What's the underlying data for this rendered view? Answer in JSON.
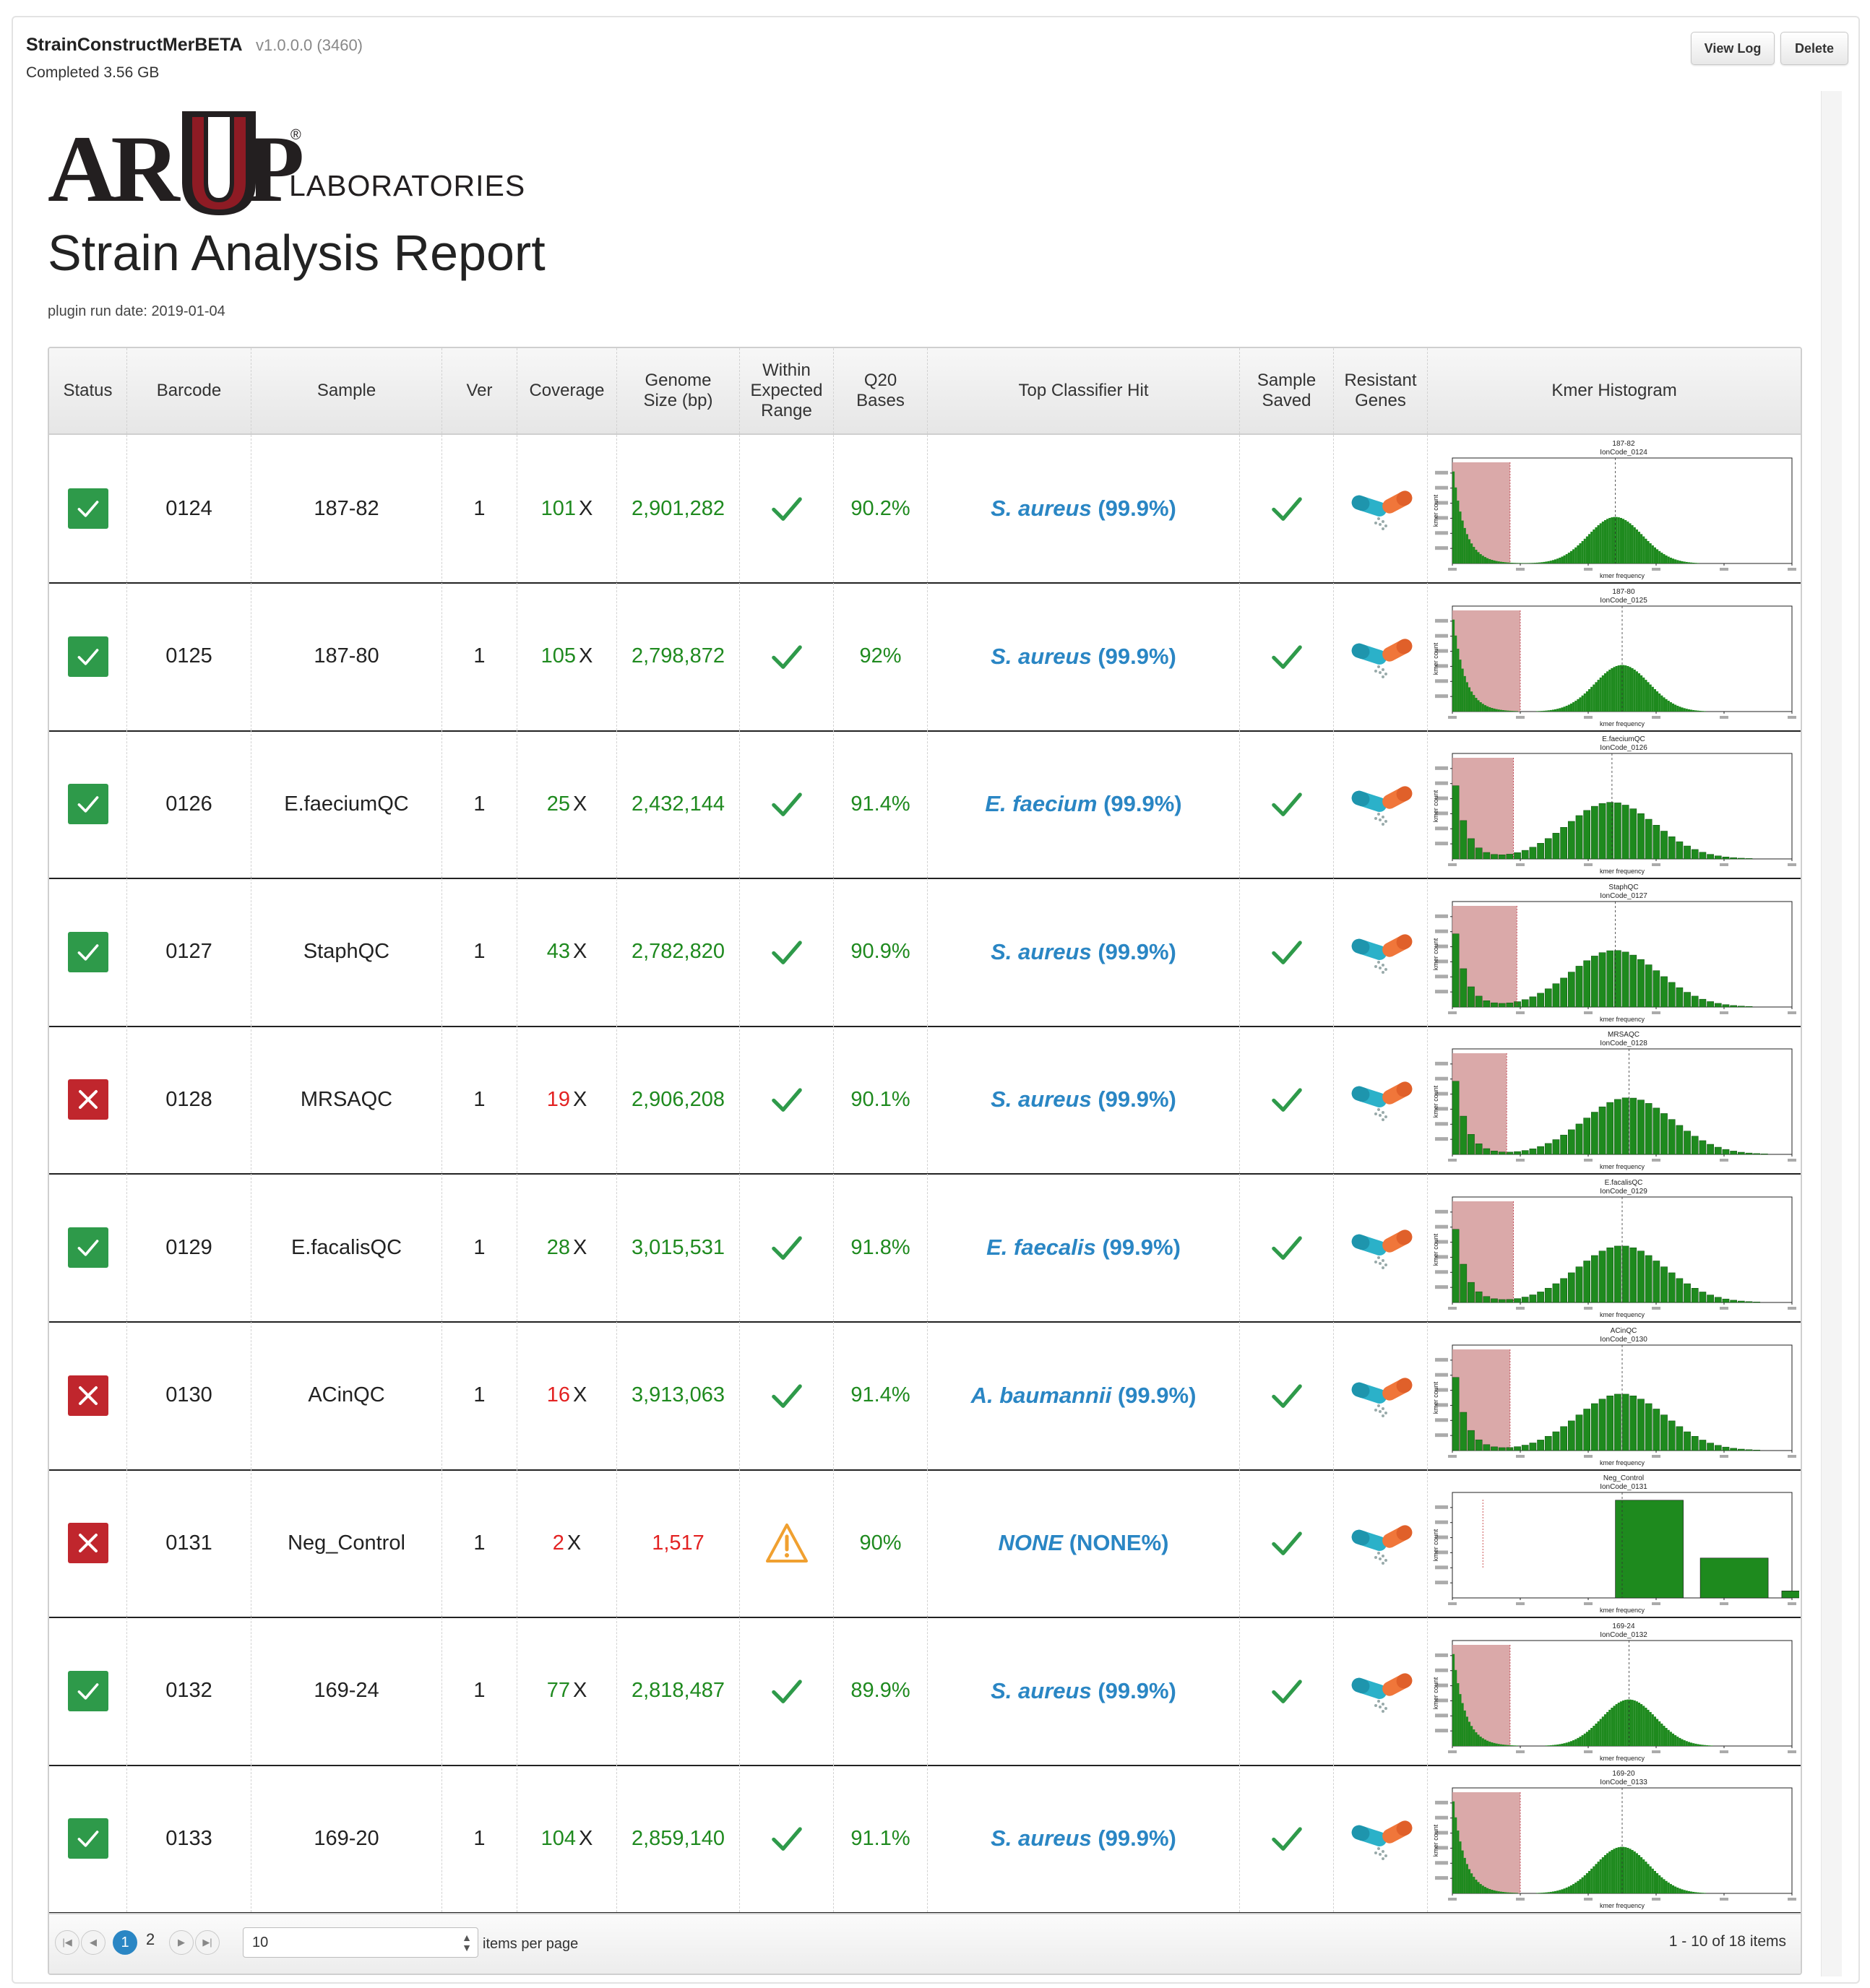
{
  "plugin": {
    "name": "StrainConstructMerBETA",
    "version": "v1.0.0.0 (3460)",
    "status": "Completed 3.56 GB",
    "view_log_label": "View Log",
    "delete_label": "Delete"
  },
  "report": {
    "logo_text": "ARUP",
    "logo_sub": "LABORATORIES",
    "logo_reg": "®",
    "title": "Strain Analysis Report",
    "run_date": "plugin run date: 2019-01-04"
  },
  "colors": {
    "pass": "#2e9a4a",
    "fail": "#c0262d",
    "good_value": "#1f8a1f",
    "bad_value": "#e32222",
    "hit_blue": "#2a86c4",
    "hist_green": "#1e8a1e",
    "hist_shade": "#d49a9a",
    "warning": "#f0a030"
  },
  "table": {
    "headers": {
      "status": "Status",
      "barcode": "Barcode",
      "sample": "Sample",
      "ver": "Ver",
      "coverage": "Coverage",
      "genome_size": "Genome Size (bp)",
      "within_range": "Within Expected Range",
      "q20": "Q20 Bases",
      "top_hit": "Top Classifier Hit",
      "sample_saved": "Sample Saved",
      "resistant": "Resistant Genes",
      "kmer": "Kmer Histogram"
    },
    "rows": [
      {
        "status": "pass",
        "barcode": "0124",
        "sample": "187-82",
        "ver": "1",
        "coverage": "101",
        "coverage_ok": true,
        "genome_size": "2,901,282",
        "genome_ok": true,
        "within_range": "check",
        "q20": "90.2%",
        "hit_species": "S. aureus",
        "hit_pct": "(99.9%)",
        "hist_title1": "187-82",
        "hist_title2": "IonCode_0124",
        "hist_shape": "tall",
        "hist_peak": 0.48,
        "hist_shade_end": 0.17
      },
      {
        "status": "pass",
        "barcode": "0125",
        "sample": "187-80",
        "ver": "1",
        "coverage": "105",
        "coverage_ok": true,
        "genome_size": "2,798,872",
        "genome_ok": true,
        "within_range": "check",
        "q20": "92%",
        "hit_species": "S. aureus",
        "hit_pct": "(99.9%)",
        "hist_title1": "187-80",
        "hist_title2": "IonCode_0125",
        "hist_shape": "tall",
        "hist_peak": 0.5,
        "hist_shade_end": 0.2
      },
      {
        "status": "pass",
        "barcode": "0126",
        "sample": "E.faeciumQC",
        "ver": "1",
        "coverage": "25",
        "coverage_ok": true,
        "genome_size": "2,432,144",
        "genome_ok": true,
        "within_range": "check",
        "q20": "91.4%",
        "hit_species": "E. faecium",
        "hit_pct": "(99.9%)",
        "hist_title1": "E.faeciumQC",
        "hist_title2": "IonCode_0126",
        "hist_shape": "wide",
        "hist_peak": 0.47,
        "hist_shade_end": 0.18
      },
      {
        "status": "pass",
        "barcode": "0127",
        "sample": "StaphQC",
        "ver": "1",
        "coverage": "43",
        "coverage_ok": true,
        "genome_size": "2,782,820",
        "genome_ok": true,
        "within_range": "check",
        "q20": "90.9%",
        "hit_species": "S. aureus",
        "hit_pct": "(99.9%)",
        "hist_title1": "StaphQC",
        "hist_title2": "IonCode_0127",
        "hist_shape": "wide",
        "hist_peak": 0.48,
        "hist_shade_end": 0.19
      },
      {
        "status": "fail",
        "barcode": "0128",
        "sample": "MRSAQC",
        "ver": "1",
        "coverage": "19",
        "coverage_ok": false,
        "genome_size": "2,906,208",
        "genome_ok": true,
        "within_range": "check",
        "q20": "90.1%",
        "hit_species": "S. aureus",
        "hit_pct": "(99.9%)",
        "hist_title1": "MRSAQC",
        "hist_title2": "IonCode_0128",
        "hist_shape": "wide",
        "hist_peak": 0.52,
        "hist_shade_end": 0.16
      },
      {
        "status": "pass",
        "barcode": "0129",
        "sample": "E.facalisQC",
        "ver": "1",
        "coverage": "28",
        "coverage_ok": true,
        "genome_size": "3,015,531",
        "genome_ok": true,
        "within_range": "check",
        "q20": "91.8%",
        "hit_species": "E. faecalis",
        "hit_pct": "(99.9%)",
        "hist_title1": "E.facalisQC",
        "hist_title2": "IonCode_0129",
        "hist_shape": "wide",
        "hist_peak": 0.5,
        "hist_shade_end": 0.18
      },
      {
        "status": "fail",
        "barcode": "0130",
        "sample": "ACinQC",
        "ver": "1",
        "coverage": "16",
        "coverage_ok": false,
        "genome_size": "3,913,063",
        "genome_ok": true,
        "within_range": "check",
        "q20": "91.4%",
        "hit_species": "A. baumannii",
        "hit_pct": "(99.9%)",
        "hist_title1": "ACinQC",
        "hist_title2": "IonCode_0130",
        "hist_shape": "wide",
        "hist_peak": 0.5,
        "hist_shade_end": 0.17
      },
      {
        "status": "fail",
        "barcode": "0131",
        "sample": "Neg_Control",
        "ver": "1",
        "coverage": "2",
        "coverage_ok": false,
        "genome_size": "1,517",
        "genome_ok": false,
        "within_range": "warning",
        "q20": "90%",
        "hit_species": "NONE",
        "hit_pct": "(NONE%)",
        "hist_title1": "Neg_Control",
        "hist_title2": "IonCode_0131",
        "hist_shape": "neg",
        "hist_peak": 0.5,
        "hist_shade_end": 0.0
      },
      {
        "status": "pass",
        "barcode": "0132",
        "sample": "169-24",
        "ver": "1",
        "coverage": "77",
        "coverage_ok": true,
        "genome_size": "2,818,487",
        "genome_ok": true,
        "within_range": "check",
        "q20": "89.9%",
        "hit_species": "S. aureus",
        "hit_pct": "(99.9%)",
        "hist_title1": "169-24",
        "hist_title2": "IonCode_0132",
        "hist_shape": "tall",
        "hist_peak": 0.52,
        "hist_shade_end": 0.17
      },
      {
        "status": "pass",
        "barcode": "0133",
        "sample": "169-20",
        "ver": "1",
        "coverage": "104",
        "coverage_ok": true,
        "genome_size": "2,859,140",
        "genome_ok": true,
        "within_range": "check",
        "q20": "91.1%",
        "hit_species": "S. aureus",
        "hit_pct": "(99.9%)",
        "hist_title1": "169-20",
        "hist_title2": "IonCode_0133",
        "hist_shape": "tall",
        "hist_peak": 0.5,
        "hist_shade_end": 0.2
      }
    ]
  },
  "pager": {
    "pages": [
      "1",
      "2"
    ],
    "active_page": "1",
    "per_page_value": "10",
    "per_page_label": "items per page",
    "info": "1 - 10 of 18 items"
  }
}
